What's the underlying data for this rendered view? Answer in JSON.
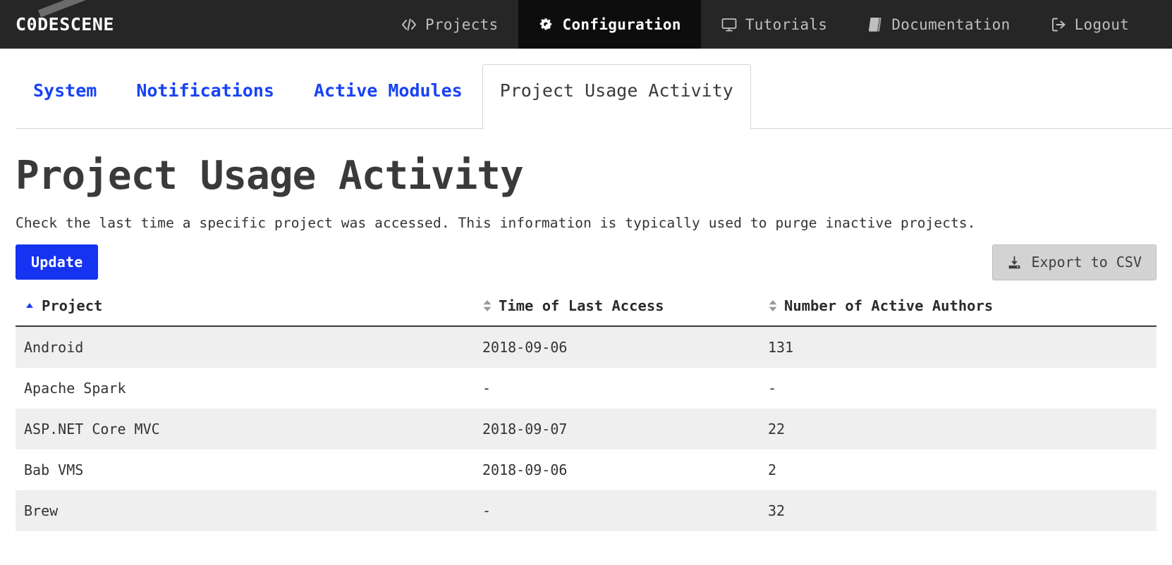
{
  "brand": {
    "logo_text": "C0DESCENE"
  },
  "topnav": {
    "items": [
      {
        "label": "Projects",
        "icon": "code-brackets-icon",
        "active": false
      },
      {
        "label": "Configuration",
        "icon": "gears-icon",
        "active": true
      },
      {
        "label": "Tutorials",
        "icon": "monitor-icon",
        "active": false
      },
      {
        "label": "Documentation",
        "icon": "book-icon",
        "active": false
      },
      {
        "label": "Logout",
        "icon": "sign-out-icon",
        "active": false
      }
    ]
  },
  "tabs": [
    {
      "label": "System",
      "active": false
    },
    {
      "label": "Notifications",
      "active": false
    },
    {
      "label": "Active Modules",
      "active": false
    },
    {
      "label": "Project Usage Activity",
      "active": true
    }
  ],
  "page": {
    "title": "Project Usage Activity",
    "description": "Check the last time a specific project was accessed. This information is typically used to purge inactive projects."
  },
  "actions": {
    "update_label": "Update",
    "export_label": "Export to CSV",
    "export_icon": "download-icon"
  },
  "table": {
    "columns": [
      {
        "label": "Project",
        "sort": "asc",
        "sort_icon": "caret-up-icon"
      },
      {
        "label": "Time of Last Access",
        "sort": "none",
        "sort_icon": "sort-updown-icon"
      },
      {
        "label": "Number of Active Authors",
        "sort": "none",
        "sort_icon": "sort-updown-icon"
      }
    ],
    "rows": [
      {
        "project": "Android",
        "last_access": "2018-09-06",
        "authors": "131"
      },
      {
        "project": "Apache Spark",
        "last_access": "-",
        "authors": "-"
      },
      {
        "project": "ASP.NET Core MVC",
        "last_access": "2018-09-07",
        "authors": "22"
      },
      {
        "project": "Bab VMS",
        "last_access": "2018-09-06",
        "authors": "2"
      },
      {
        "project": "Brew",
        "last_access": "-",
        "authors": "32"
      }
    ]
  },
  "colors": {
    "topbar_bg": "#262626",
    "topbar_active_bg": "#0d0d0d",
    "accent_blue": "#1533f0",
    "tab_link_blue": "#1742f5",
    "row_stripe": "#efefef",
    "export_bg": "#d3d3d3"
  }
}
